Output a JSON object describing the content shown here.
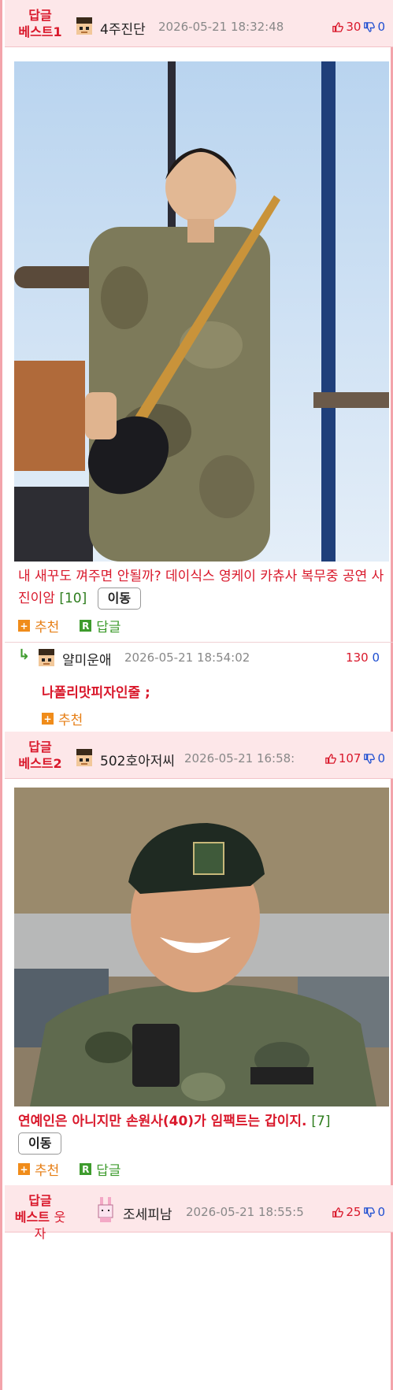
{
  "posts": [
    {
      "best_line1": "답글",
      "best_line2": "베스트1",
      "nickname": "4주진단",
      "datetime": "2026-05-21 18:32:48",
      "up_votes": "30",
      "down_votes": "0",
      "title": "내 새꾸도 껴주면 안될까? 데이식스 영케이 카츄사 복무중 공연 사진이암",
      "comment_count": "[10]",
      "move_label": "이동",
      "recommend_label": "추천",
      "reply_label": "답글"
    },
    {
      "best_line1": "답글",
      "best_line2": "베스트2",
      "nickname": "502호아저씨",
      "datetime": "2026-05-21 16:58:",
      "up_votes": "107",
      "down_votes": "0",
      "title": "연예인은 아니지만 손원사(40)가 임팩트는 갑이지.",
      "comment_count": "[7]",
      "move_label": "이동",
      "recommend_label": "추천",
      "reply_label": "답글"
    },
    {
      "best_line1": "답글",
      "best_line2a": "베스트",
      "best_line2b": "웃자",
      "nickname": "조세피남",
      "datetime": "2026-05-21 18:55:5",
      "up_votes": "25",
      "down_votes": "0"
    }
  ],
  "reply": {
    "arrow": "↳",
    "nickname": "얄미운애",
    "datetime": "2026-05-21 18:54:02",
    "up_votes": "130",
    "down_votes": "0",
    "text": "나폴리맛피자인줄 ;",
    "recommend_label": "추천"
  },
  "colors": {
    "accent_red": "#d9182b",
    "header_bg": "#fde7e9",
    "border_pink": "#f3a4ab",
    "recommend_orange": "#f08c1a",
    "reply_green": "#3e9b2d",
    "down_blue": "#1f4fd1"
  },
  "icons": [
    "pixel-avatar-icon",
    "thumbs-up-icon",
    "thumbs-down-icon",
    "plus-icon",
    "reply-r-icon",
    "bunny-avatar-icon"
  ]
}
